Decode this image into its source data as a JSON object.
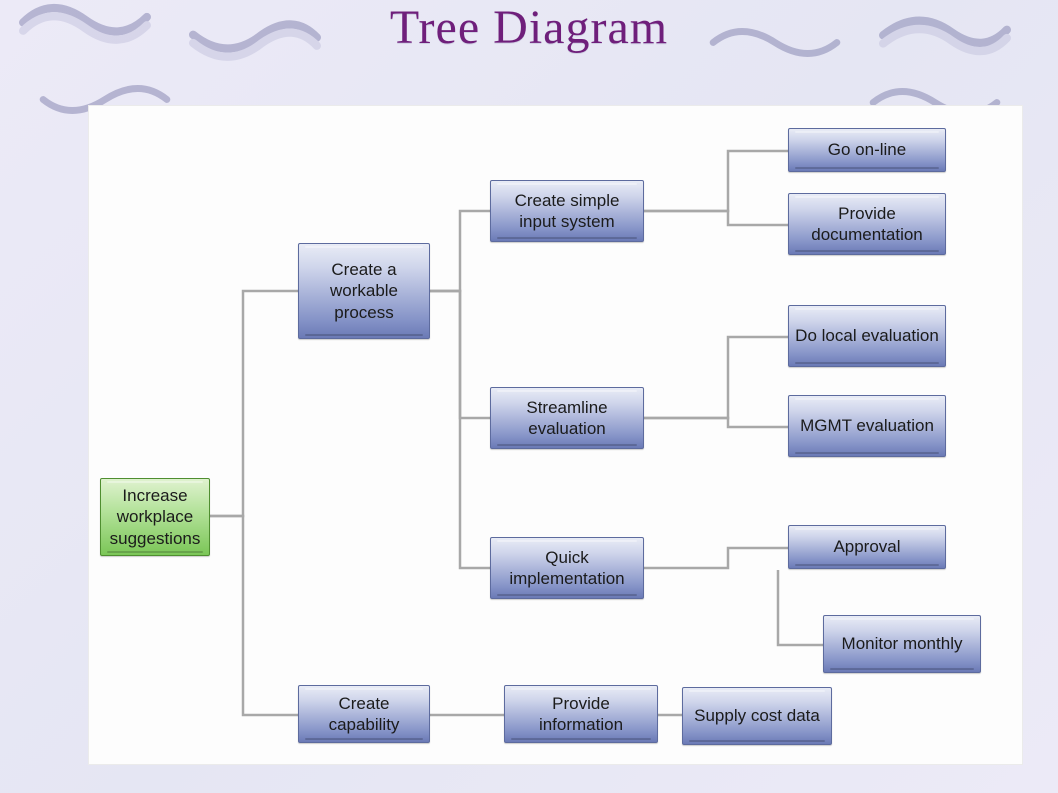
{
  "title": "Tree Diagram",
  "nodes": {
    "root": "Increase workplace suggestions",
    "workable": "Create a workable process",
    "capability": "Create capability",
    "simple_input": "Create simple input system",
    "streamline": "Streamline evaluation",
    "quick_impl": "Quick implementation",
    "provide_info": "Provide information",
    "go_online": "Go on-line",
    "provide_doc": "Provide documentation",
    "local_eval": "Do local evaluation",
    "mgmt_eval": "MGMT evaluation",
    "approval": "Approval",
    "monitor_monthly": "Monitor monthly",
    "supply_cost": "Supply cost data"
  },
  "colors": {
    "title": "#6f1f7b",
    "blue": "#8694c8",
    "green": "#7bc657",
    "line": "#a8a8a8"
  }
}
